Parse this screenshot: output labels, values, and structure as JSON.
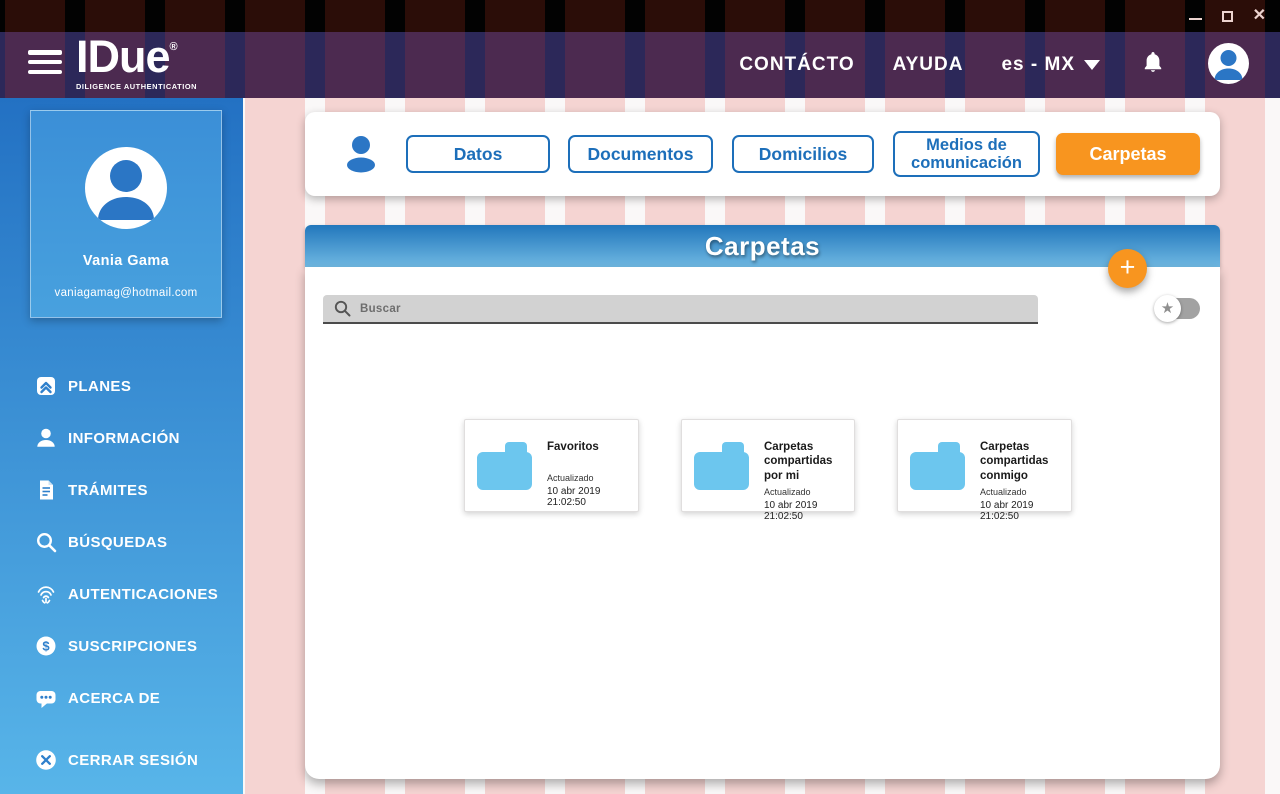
{
  "window": {
    "controls": {
      "minimize": "minimize",
      "maximize": "maximize",
      "close": "close"
    }
  },
  "header": {
    "brand": {
      "name": "IDue",
      "registered": "®",
      "tagline": "DILIGENCE AUTHENTICATION"
    },
    "nav": [
      {
        "label": "CONTÁCTO"
      },
      {
        "label": "AYUDA"
      }
    ],
    "language": {
      "selected": "es - MX"
    }
  },
  "sidebar": {
    "profile": {
      "name": "Vania Gama",
      "email": "vaniagamag@hotmail.com"
    },
    "items": [
      {
        "label": "PLANES",
        "icon": "plans-icon"
      },
      {
        "label": "INFORMACIÓN",
        "icon": "person-icon"
      },
      {
        "label": "TRÁMITES",
        "icon": "document-icon"
      },
      {
        "label": "BÚSQUEDAS",
        "icon": "search-icon"
      },
      {
        "label": "AUTENTICACIONES",
        "icon": "fingerprint-icon"
      },
      {
        "label": "SUSCRIPCIONES",
        "icon": "dollar-icon"
      },
      {
        "label": "ACERCA DE",
        "icon": "chat-icon"
      }
    ],
    "logout": {
      "label": "CERRAR SESIÓN",
      "icon": "logout-icon"
    }
  },
  "tabs": [
    {
      "label": "Datos",
      "active": false
    },
    {
      "label": "Documentos",
      "active": false
    },
    {
      "label": "Domicilios",
      "active": false
    },
    {
      "label": "Medios de comunicación",
      "active": false
    },
    {
      "label": "Carpetas",
      "active": true
    }
  ],
  "folders_panel": {
    "title": "Carpetas",
    "add_label": "+",
    "search": {
      "placeholder": "Buscar"
    },
    "favorites_toggle": {
      "state": "off",
      "icon": "star-icon"
    },
    "folders": [
      {
        "name": "Favoritos",
        "updated_label": "Actualizado",
        "updated_at": "10 abr 2019 21:02:50"
      },
      {
        "name": "Carpetas compartidas por mi",
        "updated_label": "Actualizado",
        "updated_at": "10 abr 2019 21:02:50"
      },
      {
        "name": "Carpetas compartidas conmigo",
        "updated_label": "Actualizado",
        "updated_at": "10 abr 2019 21:02:50"
      }
    ]
  },
  "colors": {
    "accent_blue": "#1d6fba",
    "accent_orange": "#f8951f",
    "sidebar_top": "#2371c3",
    "sidebar_bottom": "#58b5e9",
    "folder_icon": "#6cc6ee",
    "stripe_pink": "#f5d4d2",
    "header_stripe_purple": "#4c2a50",
    "header_stripe_navy": "#2c2859",
    "titlebar_stripe": "#2b0d08"
  }
}
